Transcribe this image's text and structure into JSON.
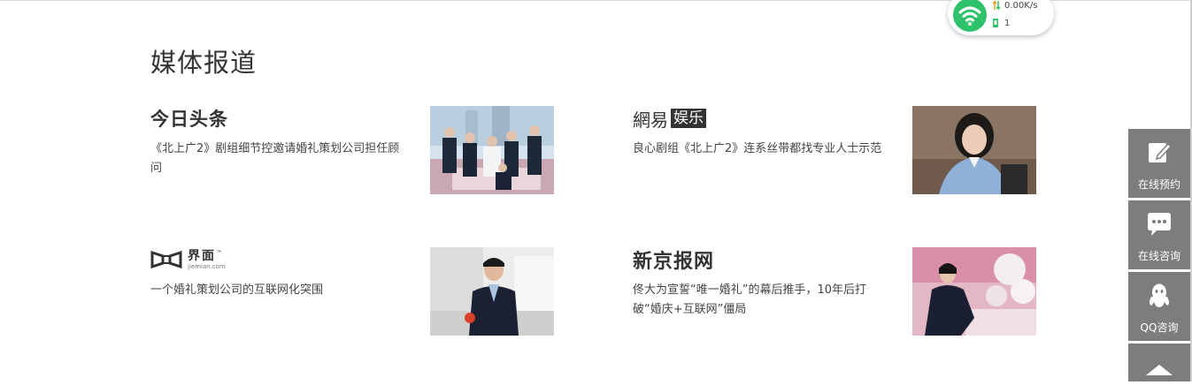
{
  "section": {
    "title": "媒体报道"
  },
  "articles": [
    {
      "source": "今日头条",
      "headline": "《北上广2》剧组细节控邀请婚礼策划公司担任顾问"
    },
    {
      "source_a": "網易",
      "source_b": "娱乐",
      "headline": "良心剧组《北上广2》连系丝带都找专业人士示范"
    },
    {
      "source": "界面",
      "source_tm": "™",
      "source_en": "jiemian.com",
      "headline": "一个婚礼策划公司的互联网化突围"
    },
    {
      "source": "新京报网",
      "headline": "佟大为宣誓“唯一婚礼”的幕后推手，10年后打破“婚庆+互联网”僵局"
    }
  ],
  "net_widget": {
    "speed": "0.00K/s",
    "count": "1"
  },
  "sidebar": {
    "items": [
      {
        "label": "在线预约",
        "icon": "edit-icon"
      },
      {
        "label": "在线咨询",
        "icon": "chat-icon"
      },
      {
        "label": "QQ咨询",
        "icon": "qq-icon"
      },
      {
        "label": "",
        "icon": "back-to-top-icon"
      }
    ]
  },
  "colors": {
    "sidebar_bg": "#7d7d7d",
    "wifi_green": "#2ec26a",
    "text": "#333333"
  }
}
